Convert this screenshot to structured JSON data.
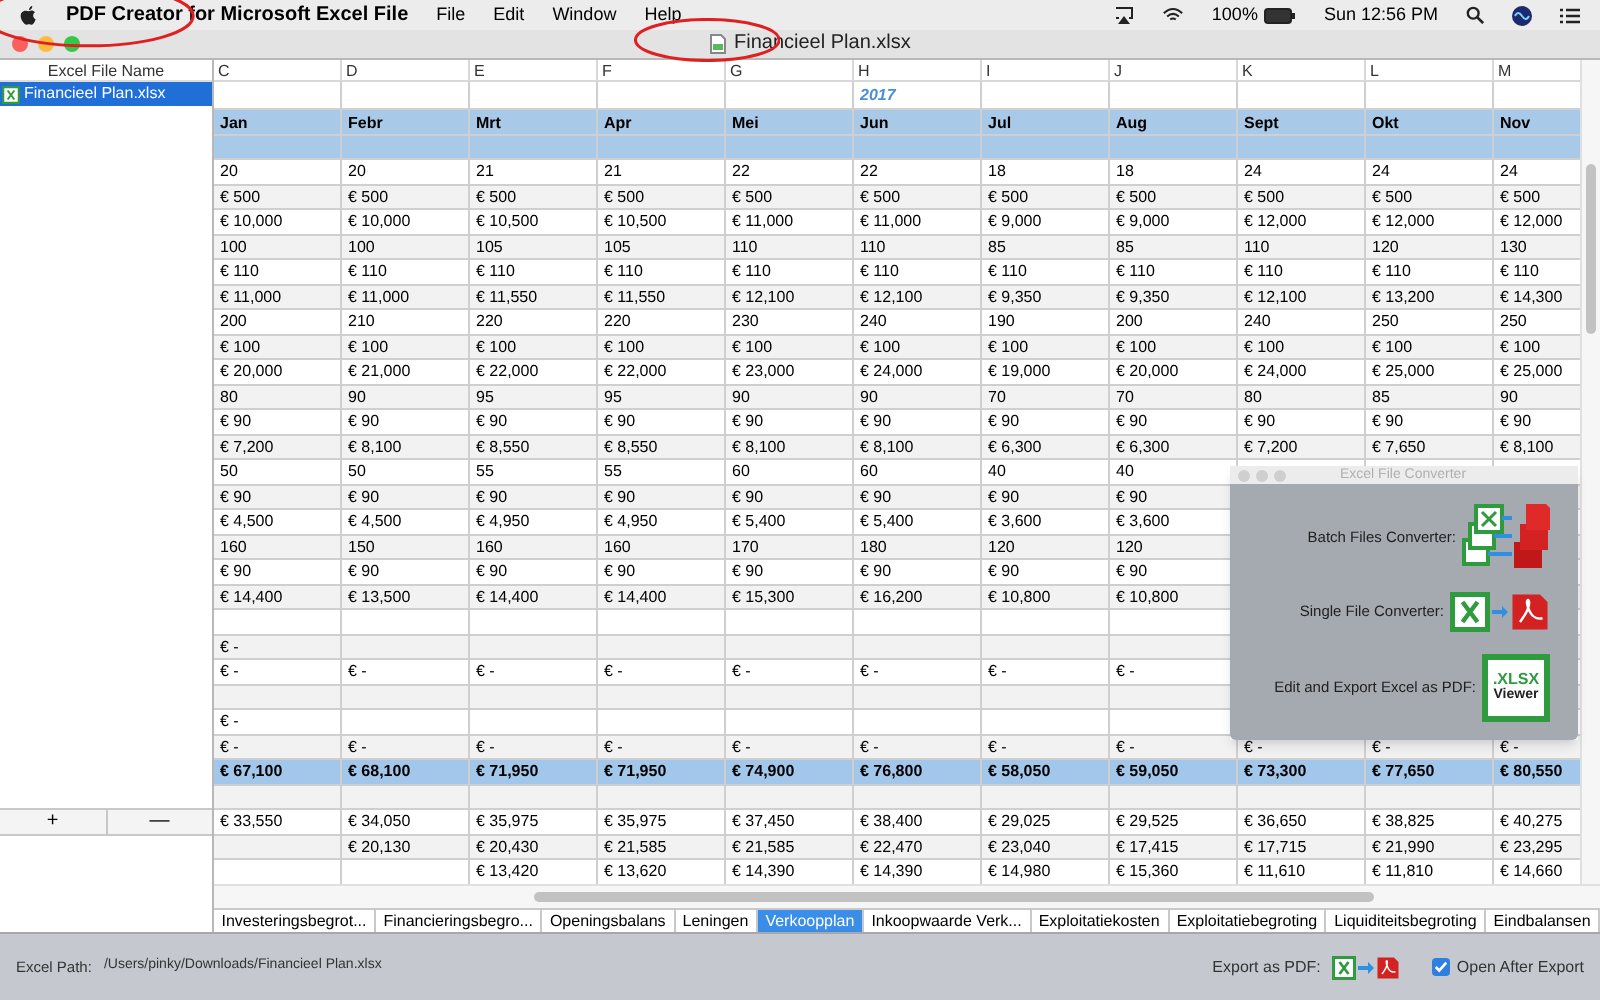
{
  "menu_bar": {
    "app_name": "PDF Creator for Microsoft Excel File",
    "app_highlighted": true,
    "menus": [
      "File",
      "Edit",
      "Window",
      "Help"
    ],
    "battery": "100%",
    "clock": "Sun 12:56 PM"
  },
  "window": {
    "title": "Financieel Plan.xlsx",
    "title_highlighted": true
  },
  "sidebar": {
    "header": "Excel File Name",
    "files": [
      {
        "name": "Financieel Plan.xlsx",
        "selected": true
      }
    ],
    "add_button": "+",
    "remove_button": "—"
  },
  "sheet": {
    "column_letters": [
      "C",
      "D",
      "E",
      "F",
      "G",
      "H",
      "I",
      "J",
      "K",
      "L",
      "M"
    ],
    "rows": [
      {
        "kind": "caption",
        "cells": [
          null,
          null,
          null,
          null,
          null,
          "2017",
          null,
          null,
          null,
          null,
          null
        ]
      },
      {
        "kind": "header",
        "cells": [
          "Jan",
          "Febr",
          "Mrt",
          "Apr",
          "Mei",
          "Jun",
          "Jul",
          "Aug",
          "Sept",
          "Okt",
          "Nov"
        ]
      },
      {
        "kind": "band",
        "cells": [
          null,
          null,
          null,
          null,
          null,
          null,
          null,
          null,
          null,
          null,
          null
        ]
      },
      {
        "kind": "data",
        "cells": [
          "20",
          "20",
          "21",
          "21",
          "22",
          "22",
          "18",
          "18",
          "24",
          "24",
          "24"
        ]
      },
      {
        "kind": "data",
        "cells": [
          "€ 500",
          "€ 500",
          "€ 500",
          "€ 500",
          "€ 500",
          "€ 500",
          "€ 500",
          "€ 500",
          "€ 500",
          "€ 500",
          "€ 500"
        ]
      },
      {
        "kind": "data",
        "cells": [
          "€ 10,000",
          "€ 10,000",
          "€ 10,500",
          "€ 10,500",
          "€ 11,000",
          "€ 11,000",
          "€ 9,000",
          "€ 9,000",
          "€ 12,000",
          "€ 12,000",
          "€ 12,000"
        ]
      },
      {
        "kind": "data",
        "cells": [
          "100",
          "100",
          "105",
          "105",
          "110",
          "110",
          "85",
          "85",
          "110",
          "120",
          "130"
        ]
      },
      {
        "kind": "data",
        "cells": [
          "€ 110",
          "€ 110",
          "€ 110",
          "€ 110",
          "€ 110",
          "€ 110",
          "€ 110",
          "€ 110",
          "€ 110",
          "€ 110",
          "€ 110"
        ]
      },
      {
        "kind": "data",
        "cells": [
          "€ 11,000",
          "€ 11,000",
          "€ 11,550",
          "€ 11,550",
          "€ 12,100",
          "€ 12,100",
          "€ 9,350",
          "€ 9,350",
          "€ 12,100",
          "€ 13,200",
          "€ 14,300"
        ]
      },
      {
        "kind": "data",
        "cells": [
          "200",
          "210",
          "220",
          "220",
          "230",
          "240",
          "190",
          "200",
          "240",
          "250",
          "250"
        ]
      },
      {
        "kind": "data",
        "cells": [
          "€ 100",
          "€ 100",
          "€ 100",
          "€ 100",
          "€ 100",
          "€ 100",
          "€ 100",
          "€ 100",
          "€ 100",
          "€ 100",
          "€ 100"
        ]
      },
      {
        "kind": "data",
        "cells": [
          "€ 20,000",
          "€ 21,000",
          "€ 22,000",
          "€ 22,000",
          "€ 23,000",
          "€ 24,000",
          "€ 19,000",
          "€ 20,000",
          "€ 24,000",
          "€ 25,000",
          "€ 25,000"
        ]
      },
      {
        "kind": "data",
        "cells": [
          "80",
          "90",
          "95",
          "95",
          "90",
          "90",
          "70",
          "70",
          "80",
          "85",
          "90"
        ]
      },
      {
        "kind": "data",
        "cells": [
          "€ 90",
          "€ 90",
          "€ 90",
          "€ 90",
          "€ 90",
          "€ 90",
          "€ 90",
          "€ 90",
          "€ 90",
          "€ 90",
          "€ 90"
        ]
      },
      {
        "kind": "data",
        "cells": [
          "€ 7,200",
          "€ 8,100",
          "€ 8,550",
          "€ 8,550",
          "€ 8,100",
          "€ 8,100",
          "€ 6,300",
          "€ 6,300",
          "€ 7,200",
          "€ 7,650",
          "€ 8,100"
        ]
      },
      {
        "kind": "data",
        "cells": [
          "50",
          "50",
          "55",
          "55",
          "60",
          "60",
          "40",
          "40",
          null,
          null,
          null
        ]
      },
      {
        "kind": "data",
        "cells": [
          "€ 90",
          "€ 90",
          "€ 90",
          "€ 90",
          "€ 90",
          "€ 90",
          "€ 90",
          "€ 90",
          null,
          null,
          null
        ]
      },
      {
        "kind": "data",
        "cells": [
          "€ 4,500",
          "€ 4,500",
          "€ 4,950",
          "€ 4,950",
          "€ 5,400",
          "€ 5,400",
          "€ 3,600",
          "€ 3,600",
          null,
          null,
          null
        ]
      },
      {
        "kind": "data",
        "cells": [
          "160",
          "150",
          "160",
          "160",
          "170",
          "180",
          "120",
          "120",
          null,
          null,
          null
        ]
      },
      {
        "kind": "data",
        "cells": [
          "€ 90",
          "€ 90",
          "€ 90",
          "€ 90",
          "€ 90",
          "€ 90",
          "€ 90",
          "€ 90",
          null,
          null,
          null
        ]
      },
      {
        "kind": "data",
        "cells": [
          "€ 14,400",
          "€ 13,500",
          "€ 14,400",
          "€ 14,400",
          "€ 15,300",
          "€ 16,200",
          "€ 10,800",
          "€ 10,800",
          null,
          null,
          null
        ]
      },
      {
        "kind": "data",
        "cells": [
          null,
          null,
          null,
          null,
          null,
          null,
          null,
          null,
          null,
          null,
          null
        ]
      },
      {
        "kind": "data",
        "cells": [
          "€ -",
          null,
          null,
          null,
          null,
          null,
          null,
          null,
          null,
          null,
          null
        ]
      },
      {
        "kind": "data",
        "cells": [
          "€ -",
          "€ -",
          "€ -",
          "€ -",
          "€ -",
          "€ -",
          "€ -",
          "€ -",
          null,
          null,
          null
        ]
      },
      {
        "kind": "data",
        "cells": [
          null,
          null,
          null,
          null,
          null,
          null,
          null,
          null,
          null,
          null,
          null
        ]
      },
      {
        "kind": "data",
        "cells": [
          "€ -",
          null,
          null,
          null,
          null,
          null,
          null,
          null,
          null,
          null,
          null
        ]
      },
      {
        "kind": "data",
        "cells": [
          "€ -",
          "€ -",
          "€ -",
          "€ -",
          "€ -",
          "€ -",
          "€ -",
          "€ -",
          "€ -",
          "€ -",
          "€ -"
        ]
      },
      {
        "kind": "total",
        "cells": [
          "€ 67,100",
          "€ 68,100",
          "€ 71,950",
          "€ 71,950",
          "€ 74,900",
          "€ 76,800",
          "€ 58,050",
          "€ 59,050",
          "€ 73,300",
          "€ 77,650",
          "€ 80,550"
        ]
      },
      {
        "kind": "data",
        "cells": [
          null,
          null,
          null,
          null,
          null,
          null,
          null,
          null,
          null,
          null,
          null
        ]
      },
      {
        "kind": "data",
        "cells": [
          "€ 33,550",
          "€ 34,050",
          "€ 35,975",
          "€ 35,975",
          "€ 37,450",
          "€ 38,400",
          "€ 29,025",
          "€ 29,525",
          "€ 36,650",
          "€ 38,825",
          "€ 40,275"
        ]
      },
      {
        "kind": "data",
        "cells": [
          null,
          "€ 20,130",
          "€ 20,430",
          "€ 21,585",
          "€ 21,585",
          "€ 22,470",
          "€ 23,040",
          "€ 17,415",
          "€ 17,715",
          "€ 21,990",
          "€ 23,295"
        ]
      },
      {
        "kind": "data",
        "cells": [
          null,
          null,
          "€ 13,420",
          "€ 13,620",
          "€ 14,390",
          "€ 14,390",
          "€ 14,980",
          "€ 15,360",
          "€ 11,610",
          "€ 11,810",
          "€ 14,660"
        ]
      }
    ]
  },
  "sheet_tabs": [
    {
      "label": "Investeringsbegrot...",
      "selected": false
    },
    {
      "label": "Financieringsbegro...",
      "selected": false
    },
    {
      "label": "Openingsbalans",
      "selected": false
    },
    {
      "label": "Leningen",
      "selected": false
    },
    {
      "label": "Verkoopplan",
      "selected": true
    },
    {
      "label": "Inkoopwaarde Verk...",
      "selected": false
    },
    {
      "label": "Exploitatiekosten",
      "selected": false
    },
    {
      "label": "Exploitatiebegroting",
      "selected": false
    },
    {
      "label": "Liquiditeitsbegroting",
      "selected": false
    },
    {
      "label": "Eindbalansen",
      "selected": false
    }
  ],
  "converter_panel": {
    "title": "Excel File Converter",
    "items": [
      {
        "kind": "batch",
        "label": "Batch Files Converter:"
      },
      {
        "kind": "single",
        "label": "Single File Converter:"
      },
      {
        "kind": "viewer",
        "label": "Edit and Export Excel as PDF:",
        "icon_text": [
          ".XLSX",
          "Viewer"
        ]
      }
    ]
  },
  "status_bar": {
    "path_label": "Excel Path:",
    "path": "/Users/pinky/Downloads/Financieel Plan.xlsx",
    "export_label": "Export as PDF:",
    "open_after_export": {
      "label": "Open After Export",
      "checked": true
    }
  }
}
